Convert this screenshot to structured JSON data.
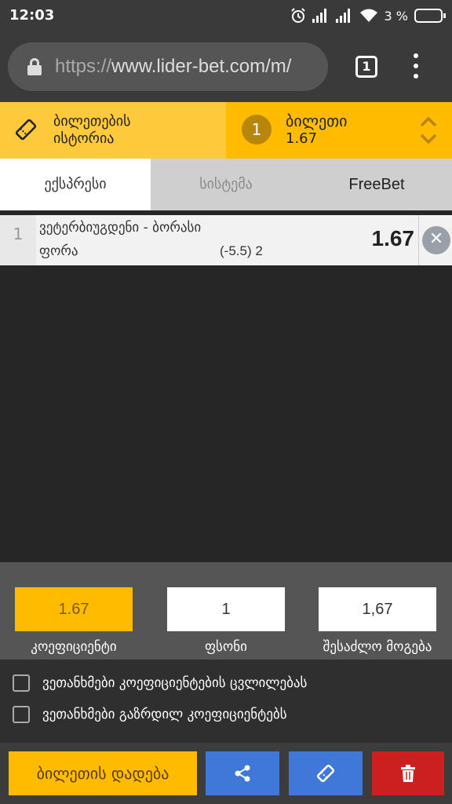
{
  "status_bar": {
    "time": "12:03",
    "battery": "3 %",
    "icons": [
      "alarm-icon",
      "signal-icon",
      "signal-icon",
      "wifi-icon",
      "battery-charging-icon"
    ]
  },
  "browser": {
    "url_scheme": "https://",
    "url_rest": "www.lider-bet.com/m/",
    "tab_count": "1"
  },
  "header": {
    "history_label_line1": "ბილეთების",
    "history_label_line2": "ისტორია",
    "ticket_count": "1",
    "ticket_title": "ბილეთი",
    "ticket_odds": "1.67"
  },
  "bet_type_tabs": [
    {
      "label": "ექსპრესი",
      "active": true
    },
    {
      "label": "სისტემა",
      "active": false
    },
    {
      "label": "FreeBet",
      "active": false
    }
  ],
  "bets": [
    {
      "index": "1",
      "match": "ვეტერბიუგდენი - ბორასი",
      "market": "ფორა",
      "selection": "(-5.5) 2",
      "odds": "1.67"
    }
  ],
  "summary": {
    "coefficient_value": "1.67",
    "coefficient_label": "კოეფიციენტი",
    "stake_value": "1",
    "stake_label": "ფსონი",
    "payout_value": "1,67",
    "payout_label": "შესაძლო მოგება"
  },
  "options": {
    "accept_odds_change": "ვეთანხმები კოეფიციენტების ცვლილებას",
    "accept_increased_odds": "ვეთანხმები გაზრდილ კოეფიციენტებს"
  },
  "actions": {
    "place_bet": "ბილეთის დადება"
  },
  "colors": {
    "accent": "#ffbb00",
    "accent_light": "#ffc93c",
    "blue": "#3f78d8",
    "red": "#cc1f1f"
  }
}
